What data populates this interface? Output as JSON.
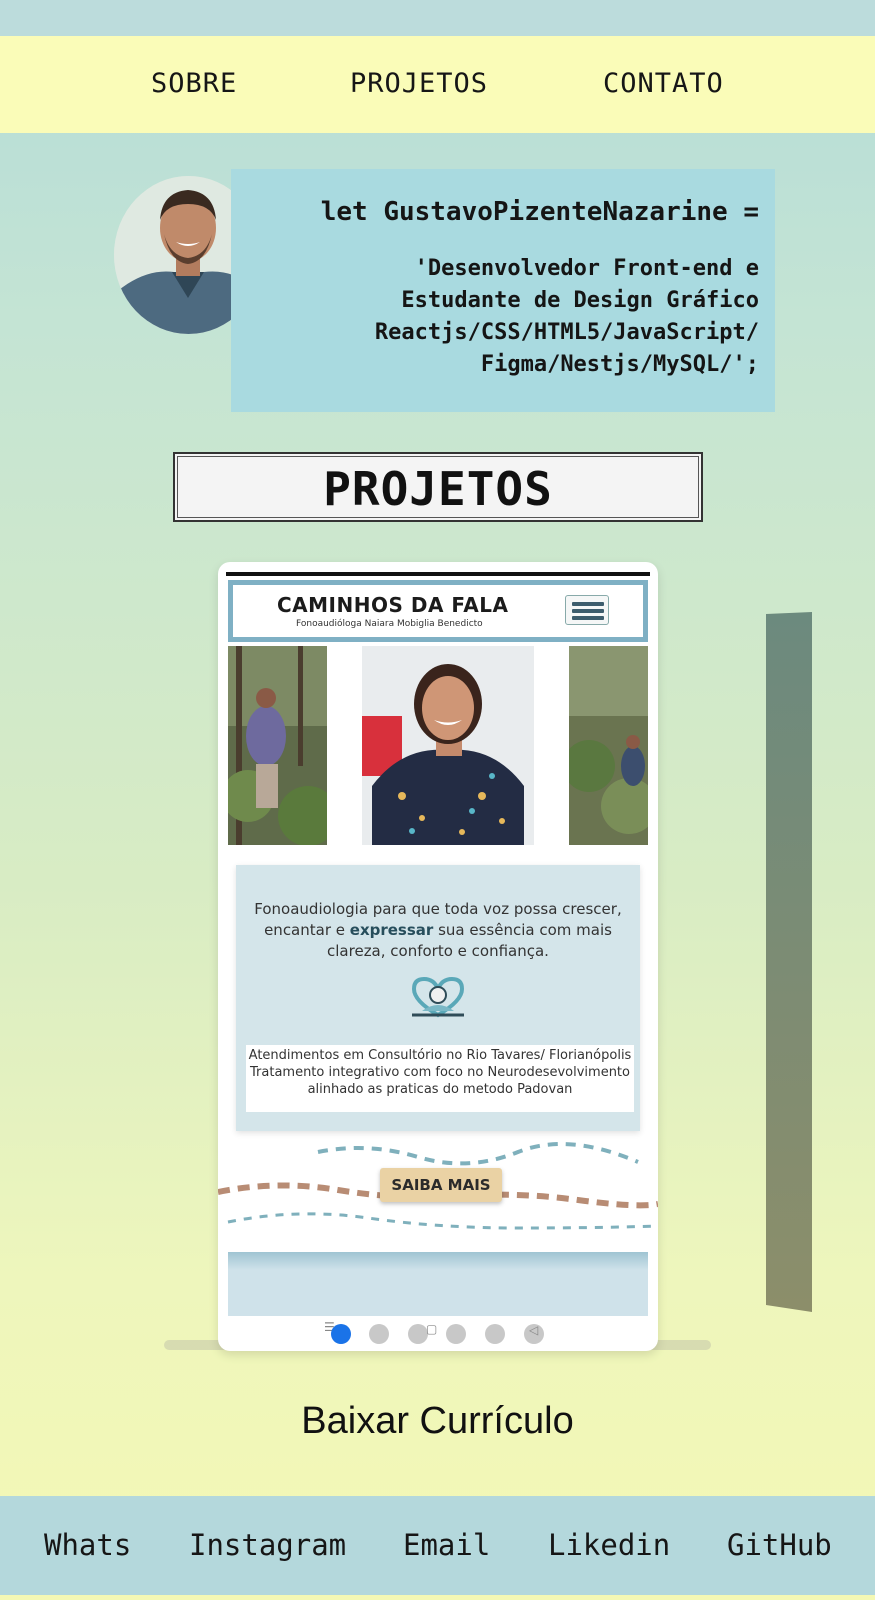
{
  "nav": {
    "items": [
      {
        "label": "SOBRE"
      },
      {
        "label": "PROJETOS"
      },
      {
        "label": "CONTATO"
      }
    ]
  },
  "profile": {
    "code_declaration": "let GustavoPizenteNazarine =",
    "code_value_lines": [
      "'Desenvolvedor Front-end e",
      "Estudante de Design Gráfico",
      "Reactjs/CSS/HTML5/JavaScript/",
      "Figma/Nestjs/MySQL/';"
    ]
  },
  "projects": {
    "heading": "PROJETOS",
    "slide": {
      "site_title": "CAMINHOS DA FALA",
      "site_subtitle": "Fonoaudióloga Naiara Mobiglia Benedicto",
      "hero_text_pre": "Fonoaudiologia para que toda voz possa crescer, encantar e ",
      "hero_text_bold": "expressar",
      "hero_text_post": " sua essência com mais clareza, conforto e confiança.",
      "info_text": "Atendimentos em Consultório no Rio Tavares/ Florianópolis Tratamento integrativo com foco no Neurodesevolvimento alinhado as praticas do metodo Padovan",
      "cta_label": "SAIBA MAIS"
    },
    "dots_total": 6,
    "active_dot": 1,
    "colors": {
      "active_dot": "#1a73e8",
      "inactive_dot": "#c8c8c8"
    }
  },
  "cv": {
    "label": "Baixar Currículo"
  },
  "footer": {
    "links": [
      {
        "label": "Whats"
      },
      {
        "label": "Instagram"
      },
      {
        "label": "Email"
      },
      {
        "label": "Likedin"
      },
      {
        "label": "GitHub"
      }
    ]
  },
  "colors": {
    "navbar_bg": "#fafcb8",
    "codebox_bg": "#a9dae0",
    "footer_bg": "#b4d8dc"
  }
}
